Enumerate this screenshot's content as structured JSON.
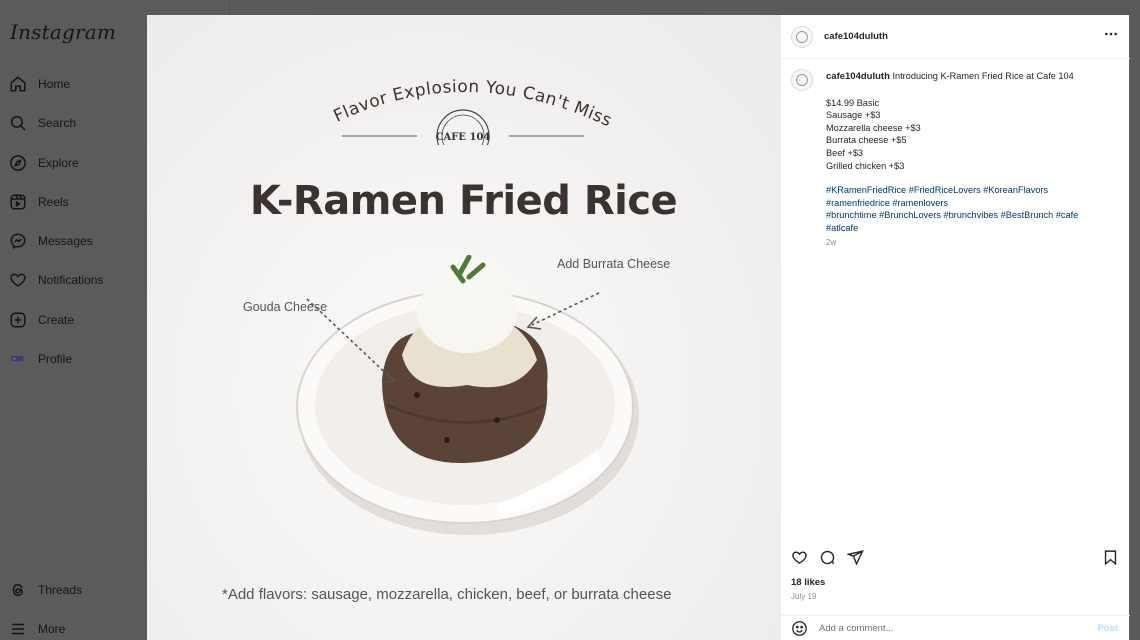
{
  "app": {
    "logo": "Instagram"
  },
  "sidebar": {
    "items": [
      {
        "label": "Home",
        "icon": "home-icon"
      },
      {
        "label": "Search",
        "icon": "search-icon"
      },
      {
        "label": "Explore",
        "icon": "compass-icon"
      },
      {
        "label": "Reels",
        "icon": "reels-icon"
      },
      {
        "label": "Messages",
        "icon": "messenger-icon"
      },
      {
        "label": "Notifications",
        "icon": "heart-icon"
      },
      {
        "label": "Create",
        "icon": "plus-square-icon"
      },
      {
        "label": "Profile",
        "icon": "avatar-icon"
      }
    ],
    "bottom_items": [
      {
        "label": "Threads",
        "icon": "threads-icon"
      },
      {
        "label": "More",
        "icon": "menu-icon"
      }
    ]
  },
  "post": {
    "image": {
      "tagline": "A Flavor Explosion You Can't Miss!",
      "logo_text": "CAFE 104",
      "headline": "K-Ramen Fried Rice",
      "callout_left": "Gouda Cheese",
      "callout_right": "Add Burrata Cheese",
      "footnote": "*Add flavors: sausage, mozzarella, chicken, beef, or burrata cheese"
    },
    "header": {
      "username": "cafe104duluth",
      "more_icon": "more-horizontal-icon"
    },
    "caption": {
      "username": "cafe104duluth",
      "intro": "Introducing K-Ramen Fried Rice at Cafe 104",
      "price_lines": [
        "$14.99 Basic",
        "Sausage +$3",
        "Mozzarella cheese +$3",
        "Burrata cheese +$5",
        "Beef +$3",
        "Grilled chicken +$3"
      ],
      "hashtag_lines": [
        "#KRamenFriedRice #FriedRiceLovers #KoreanFlavors",
        "#ramenfriedrice #ramenlovers",
        "#brunchtime #BrunchLovers #brunchvibes #BestBrunch #cafe",
        "#atlcafe"
      ],
      "age": "2w"
    },
    "likes": "18 likes",
    "date": "July 19",
    "comment": {
      "placeholder": "Add a comment...",
      "post_label": "Post"
    }
  },
  "colors": {
    "link": "#00376b",
    "post_button": "#b2dffc",
    "overlay": "#5a5a5a"
  }
}
